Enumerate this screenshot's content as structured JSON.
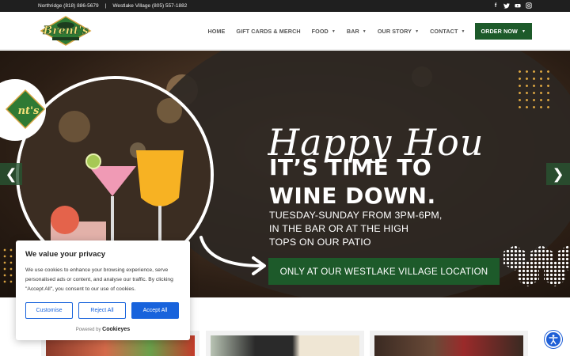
{
  "topbar": {
    "northridge": "Northridge (818) 886-5679",
    "separator": "|",
    "westlake": "Westlake Village (805) 557-1882",
    "social_icons": [
      "facebook-icon",
      "twitter-icon",
      "youtube-icon",
      "instagram-icon"
    ]
  },
  "logo": {
    "script": "Brent's",
    "small_top": "EST. 1969",
    "small_bottom": "DELICATESSEN & RESTAURANT"
  },
  "nav": {
    "home": "HOME",
    "gift": "GIFT CARDS & MERCH",
    "food": "FOOD",
    "bar": "BAR",
    "story": "OUR STORY",
    "contact": "CONTACT",
    "order": "ORDER NOW"
  },
  "hero": {
    "script_title": "Happy Hour",
    "tagline_line1": "IT’S TIME TO",
    "tagline_line2": "WINE DOWN.",
    "hours_line1": "TUESDAY-SUNDAY FROM 3PM-6PM,",
    "hours_line2": "IN THE BAR OR AT THE HIGH",
    "hours_line3": "TOPS ON OUR PATIO",
    "location_button": "ONLY AT OUR WESTLAKE VILLAGE LOCATION",
    "prev_arrow": "❮",
    "next_arrow": "❯"
  },
  "cookie": {
    "title": "We value your privacy",
    "body": "We use cookies to enhance your browsing experience, serve personalised ads or content, and analyse our traffic. By clicking \"Accept All\", you consent to our use of cookies.",
    "customise": "Customise",
    "reject": "Reject All",
    "accept": "Accept All",
    "powered_by": "Powered by",
    "brand": "Cookieyes"
  },
  "colors": {
    "brand_green": "#1d5a2a",
    "cookie_blue": "#1863dc",
    "gold_dots": "#d9a441",
    "topbar": "#1f1f1f"
  }
}
